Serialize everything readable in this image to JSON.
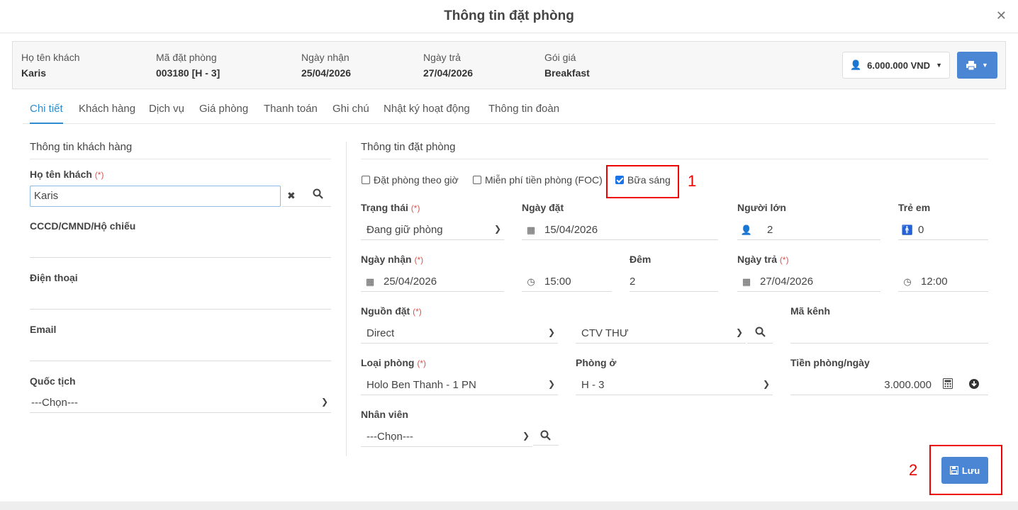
{
  "modal": {
    "title": "Thông tin đặt phòng"
  },
  "summary": {
    "guest_label": "Họ tên khách",
    "guest_value": "Karis",
    "booking_label": "Mã đặt phòng",
    "booking_value": "003180 [H - 3]",
    "checkin_label": "Ngày nhận",
    "checkin_value": "25/04/2026",
    "checkout_label": "Ngày trả",
    "checkout_value": "27/04/2026",
    "rate_label": "Gói giá",
    "rate_value": "Breakfast",
    "price_button": "6.000.000 VND"
  },
  "tabs": [
    "Chi tiết",
    "Khách hàng",
    "Dịch vụ",
    "Giá phòng",
    "Thanh toán",
    "Ghi chú",
    "Nhật ký hoạt động",
    "Thông tin đoàn"
  ],
  "left": {
    "section_title": "Thông tin khách hàng",
    "name_label": "Họ tên khách",
    "required_mark": "(*)",
    "name_value": "Karis",
    "id_label": "CCCD/CMND/Hộ chiếu",
    "phone_label": "Điện thoại",
    "email_label": "Email",
    "nationality_label": "Quốc tịch",
    "nationality_value": "---Chọn---"
  },
  "right": {
    "section_title": "Thông tin đặt phòng",
    "hourly_label": "Đặt phòng theo giờ",
    "foc_label": "Miễn phí tiền phòng (FOC)",
    "breakfast_label": "Bữa sáng",
    "status_label": "Trạng thái",
    "status_value": "Đang giữ phòng",
    "booked_date_label": "Ngày đặt",
    "booked_date_value": "15/04/2026",
    "adults_label": "Người lớn",
    "adults_value": "2",
    "children_label": "Trẻ em",
    "children_value": "0",
    "checkin_label": "Ngày nhận",
    "checkin_date": "25/04/2026",
    "checkin_time": "15:00",
    "nights_label": "Đêm",
    "nights_value": "2",
    "checkout_label": "Ngày trả",
    "checkout_date": "27/04/2026",
    "checkout_time": "12:00",
    "source_label": "Nguồn đặt",
    "source_value": "Direct",
    "agent_value": "CTV THƯ",
    "channel_label": "Mã kênh",
    "room_type_label": "Loại phòng",
    "room_type_value": "Holo Ben Thanh - 1 PN",
    "room_label": "Phòng ở",
    "room_value": "H - 3",
    "rate_label": "Tiền phòng/ngày",
    "rate_value": "3.000.000",
    "staff_label": "Nhân viên",
    "staff_value": "---Chọn---"
  },
  "annotations": {
    "one": "1",
    "two": "2"
  },
  "save_label": "Lưu"
}
